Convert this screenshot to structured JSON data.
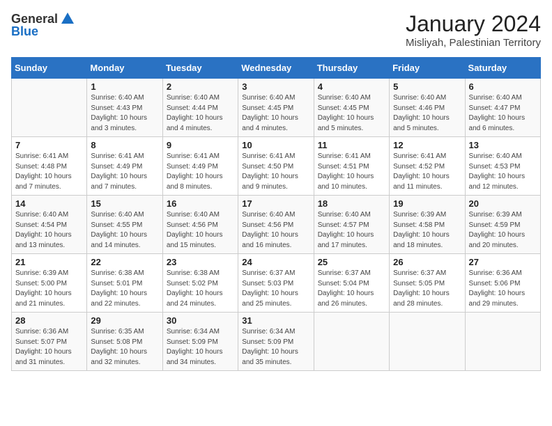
{
  "header": {
    "logo_general": "General",
    "logo_blue": "Blue",
    "month_title": "January 2024",
    "location": "Misliyah, Palestinian Territory"
  },
  "days_of_week": [
    "Sunday",
    "Monday",
    "Tuesday",
    "Wednesday",
    "Thursday",
    "Friday",
    "Saturday"
  ],
  "weeks": [
    [
      {
        "day": "",
        "info": ""
      },
      {
        "day": "1",
        "info": "Sunrise: 6:40 AM\nSunset: 4:43 PM\nDaylight: 10 hours\nand 3 minutes."
      },
      {
        "day": "2",
        "info": "Sunrise: 6:40 AM\nSunset: 4:44 PM\nDaylight: 10 hours\nand 4 minutes."
      },
      {
        "day": "3",
        "info": "Sunrise: 6:40 AM\nSunset: 4:45 PM\nDaylight: 10 hours\nand 4 minutes."
      },
      {
        "day": "4",
        "info": "Sunrise: 6:40 AM\nSunset: 4:45 PM\nDaylight: 10 hours\nand 5 minutes."
      },
      {
        "day": "5",
        "info": "Sunrise: 6:40 AM\nSunset: 4:46 PM\nDaylight: 10 hours\nand 5 minutes."
      },
      {
        "day": "6",
        "info": "Sunrise: 6:40 AM\nSunset: 4:47 PM\nDaylight: 10 hours\nand 6 minutes."
      }
    ],
    [
      {
        "day": "7",
        "info": "Sunrise: 6:41 AM\nSunset: 4:48 PM\nDaylight: 10 hours\nand 7 minutes."
      },
      {
        "day": "8",
        "info": "Sunrise: 6:41 AM\nSunset: 4:49 PM\nDaylight: 10 hours\nand 7 minutes."
      },
      {
        "day": "9",
        "info": "Sunrise: 6:41 AM\nSunset: 4:49 PM\nDaylight: 10 hours\nand 8 minutes."
      },
      {
        "day": "10",
        "info": "Sunrise: 6:41 AM\nSunset: 4:50 PM\nDaylight: 10 hours\nand 9 minutes."
      },
      {
        "day": "11",
        "info": "Sunrise: 6:41 AM\nSunset: 4:51 PM\nDaylight: 10 hours\nand 10 minutes."
      },
      {
        "day": "12",
        "info": "Sunrise: 6:41 AM\nSunset: 4:52 PM\nDaylight: 10 hours\nand 11 minutes."
      },
      {
        "day": "13",
        "info": "Sunrise: 6:40 AM\nSunset: 4:53 PM\nDaylight: 10 hours\nand 12 minutes."
      }
    ],
    [
      {
        "day": "14",
        "info": "Sunrise: 6:40 AM\nSunset: 4:54 PM\nDaylight: 10 hours\nand 13 minutes."
      },
      {
        "day": "15",
        "info": "Sunrise: 6:40 AM\nSunset: 4:55 PM\nDaylight: 10 hours\nand 14 minutes."
      },
      {
        "day": "16",
        "info": "Sunrise: 6:40 AM\nSunset: 4:56 PM\nDaylight: 10 hours\nand 15 minutes."
      },
      {
        "day": "17",
        "info": "Sunrise: 6:40 AM\nSunset: 4:56 PM\nDaylight: 10 hours\nand 16 minutes."
      },
      {
        "day": "18",
        "info": "Sunrise: 6:40 AM\nSunset: 4:57 PM\nDaylight: 10 hours\nand 17 minutes."
      },
      {
        "day": "19",
        "info": "Sunrise: 6:39 AM\nSunset: 4:58 PM\nDaylight: 10 hours\nand 18 minutes."
      },
      {
        "day": "20",
        "info": "Sunrise: 6:39 AM\nSunset: 4:59 PM\nDaylight: 10 hours\nand 20 minutes."
      }
    ],
    [
      {
        "day": "21",
        "info": "Sunrise: 6:39 AM\nSunset: 5:00 PM\nDaylight: 10 hours\nand 21 minutes."
      },
      {
        "day": "22",
        "info": "Sunrise: 6:38 AM\nSunset: 5:01 PM\nDaylight: 10 hours\nand 22 minutes."
      },
      {
        "day": "23",
        "info": "Sunrise: 6:38 AM\nSunset: 5:02 PM\nDaylight: 10 hours\nand 24 minutes."
      },
      {
        "day": "24",
        "info": "Sunrise: 6:37 AM\nSunset: 5:03 PM\nDaylight: 10 hours\nand 25 minutes."
      },
      {
        "day": "25",
        "info": "Sunrise: 6:37 AM\nSunset: 5:04 PM\nDaylight: 10 hours\nand 26 minutes."
      },
      {
        "day": "26",
        "info": "Sunrise: 6:37 AM\nSunset: 5:05 PM\nDaylight: 10 hours\nand 28 minutes."
      },
      {
        "day": "27",
        "info": "Sunrise: 6:36 AM\nSunset: 5:06 PM\nDaylight: 10 hours\nand 29 minutes."
      }
    ],
    [
      {
        "day": "28",
        "info": "Sunrise: 6:36 AM\nSunset: 5:07 PM\nDaylight: 10 hours\nand 31 minutes."
      },
      {
        "day": "29",
        "info": "Sunrise: 6:35 AM\nSunset: 5:08 PM\nDaylight: 10 hours\nand 32 minutes."
      },
      {
        "day": "30",
        "info": "Sunrise: 6:34 AM\nSunset: 5:09 PM\nDaylight: 10 hours\nand 34 minutes."
      },
      {
        "day": "31",
        "info": "Sunrise: 6:34 AM\nSunset: 5:09 PM\nDaylight: 10 hours\nand 35 minutes."
      },
      {
        "day": "",
        "info": ""
      },
      {
        "day": "",
        "info": ""
      },
      {
        "day": "",
        "info": ""
      }
    ]
  ]
}
